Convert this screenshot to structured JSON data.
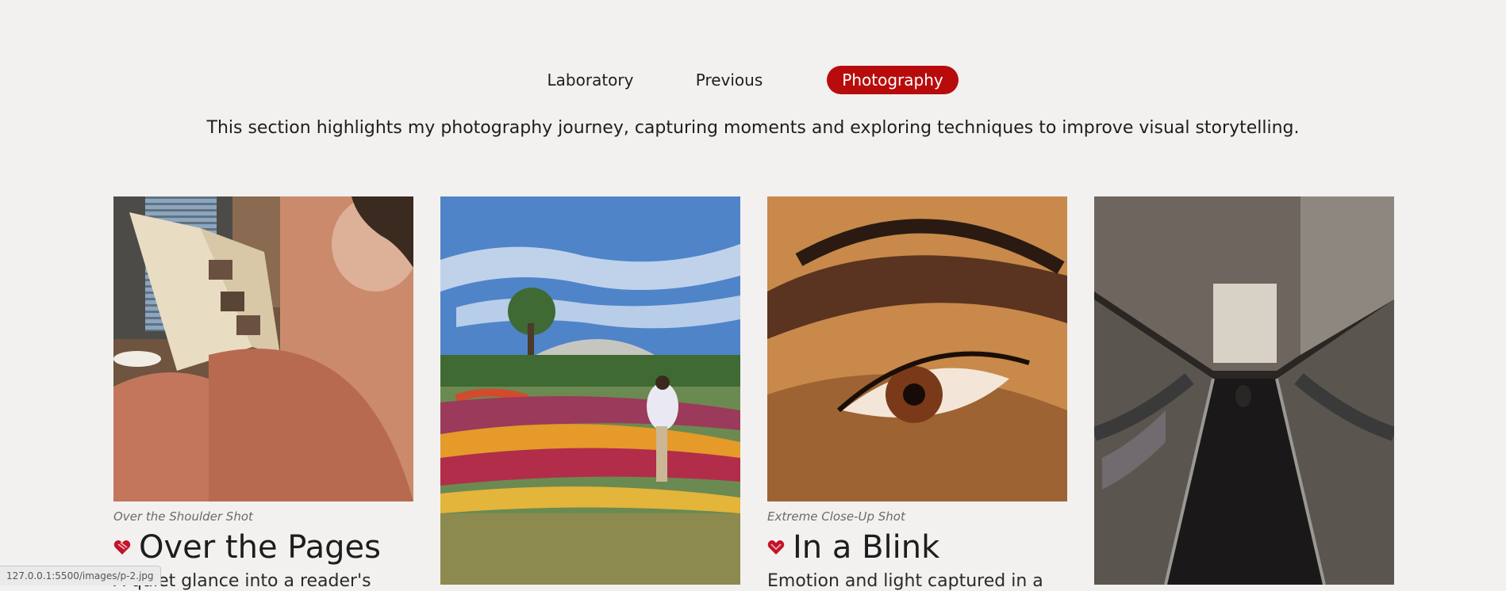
{
  "nav": {
    "tabs": [
      {
        "label": "Laboratory"
      },
      {
        "label": "Previous"
      },
      {
        "label": "Photography"
      }
    ],
    "active_index": 2
  },
  "intro": "This section highlights my photography journey, capturing moments and exploring techniques to improve visual storytelling.",
  "cards": [
    {
      "caption": "Over the Shoulder Shot",
      "title": "Over the Pages",
      "desc": "A quiet glance into a reader's"
    },
    {
      "caption": "",
      "title": "",
      "desc": ""
    },
    {
      "caption": "Extreme Close-Up Shot",
      "title": "In a Blink",
      "desc": "Emotion and light captured in a"
    },
    {
      "caption": "",
      "title": "",
      "desc": ""
    }
  ],
  "status_url": "127.0.0.1:5500/images/p-2.jpg",
  "colors": {
    "accent": "#b80c0c",
    "background": "#f2f1ef"
  }
}
